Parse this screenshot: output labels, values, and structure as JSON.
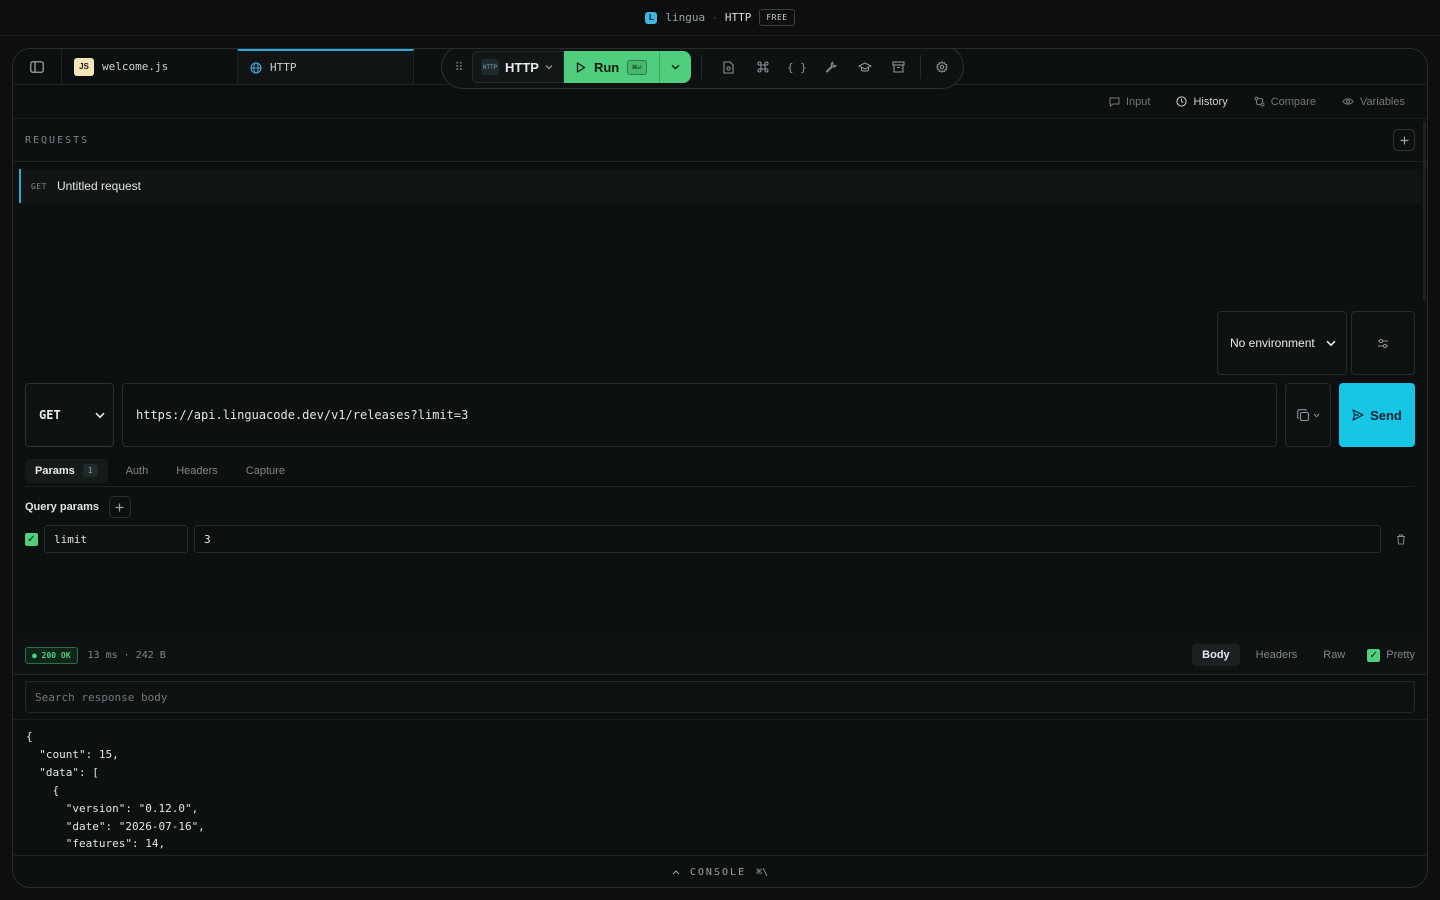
{
  "titlebar": {
    "logo_letter": "L",
    "app_name": "lingua",
    "separator": "·",
    "document": "HTTP",
    "plan_badge": "FREE"
  },
  "tabs": [
    {
      "icon": "js-badge",
      "badge_text": "JS",
      "label": "welcome.js",
      "active": false
    },
    {
      "icon": "globe-icon",
      "label": "HTTP",
      "active": true
    }
  ],
  "toolbar": {
    "language_icon_text": "HTTP",
    "language_label": "HTTP",
    "run_label": "Run",
    "run_shortcut": "⌘⏎",
    "icons": [
      "file-icon",
      "command-icon",
      "braces-icon",
      "wrench-icon",
      "graduation-cap-icon",
      "archive-icon",
      "gear-icon"
    ]
  },
  "panel_tabs": [
    {
      "label": "Input",
      "icon": "message-icon",
      "active": false
    },
    {
      "label": "History",
      "icon": "clock-icon",
      "active": true
    },
    {
      "label": "Compare",
      "icon": "compare-icon",
      "active": false
    },
    {
      "label": "Variables",
      "icon": "eye-icon",
      "active": false
    }
  ],
  "requests": {
    "header": "REQUESTS",
    "items": [
      {
        "method": "GET",
        "name": "Untitled request"
      }
    ]
  },
  "environment": {
    "selected": "No environment"
  },
  "request": {
    "method": "GET",
    "url": "https://api.linguacode.dev/v1/releases?limit=3",
    "send_label": "Send",
    "tabs": [
      {
        "label": "Params",
        "count": "1",
        "active": true
      },
      {
        "label": "Auth",
        "active": false
      },
      {
        "label": "Headers",
        "active": false
      },
      {
        "label": "Capture",
        "active": false
      }
    ],
    "query_params_label": "Query params",
    "params": [
      {
        "enabled": true,
        "key": "limit",
        "value": "3"
      }
    ]
  },
  "response": {
    "status": "● 200 OK",
    "meta": "13 ms · 242 B",
    "tabs": [
      {
        "label": "Body",
        "active": true
      },
      {
        "label": "Headers",
        "active": false
      },
      {
        "label": "Raw",
        "active": false
      }
    ],
    "pretty_label": "Pretty",
    "search_placeholder": "Search response body",
    "body_lines": [
      "{",
      "  \"count\": 15,",
      "  \"data\": [",
      "    {",
      "      \"version\": \"0.12.0\",",
      "      \"date\": \"2026-07-16\",",
      "      \"features\": 14,"
    ]
  },
  "console": {
    "label": "CONSOLE",
    "shortcut": "⌘\\"
  }
}
